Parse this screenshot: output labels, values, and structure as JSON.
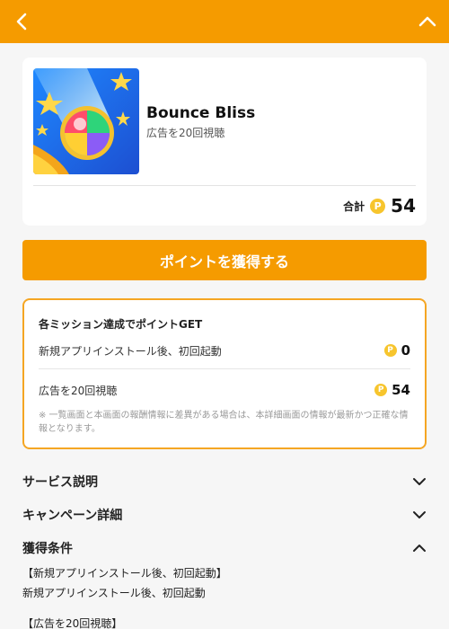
{
  "header": {
    "back_icon": "chevron-left-icon",
    "collapse_icon": "chevron-up-icon",
    "color": "#f59b00"
  },
  "app": {
    "name": "Bounce Bliss",
    "subtitle": "広告を20回視聴",
    "total_label": "合計",
    "total_points": "54",
    "coin_glyph": "P"
  },
  "cta": {
    "label": "ポイントを獲得する"
  },
  "missions": {
    "title": "各ミッション達成でポイントGET",
    "items": [
      {
        "label": "新規アプリインストール後、初回起動",
        "points": "0"
      },
      {
        "label": "広告を20回視聴",
        "points": "54"
      }
    ],
    "note": "※ 一覧画面と本画面の報酬情報に差異がある場合は、本詳細画面の情報が最新かつ正確な情報となります。"
  },
  "sections": [
    {
      "title": "サービス説明",
      "expanded": false
    },
    {
      "title": "キャンペーン詳細",
      "expanded": false
    },
    {
      "title": "獲得条件",
      "expanded": true
    }
  ],
  "conditions": {
    "line1": "【新規アプリインストール後、初回起動】",
    "line2": "新規アプリインストール後、初回起動",
    "line3": "【広告を20回視聴】"
  },
  "colors": {
    "accent": "#f59b00",
    "mission_border": "#f5a623",
    "coin": "#f7c52d"
  }
}
